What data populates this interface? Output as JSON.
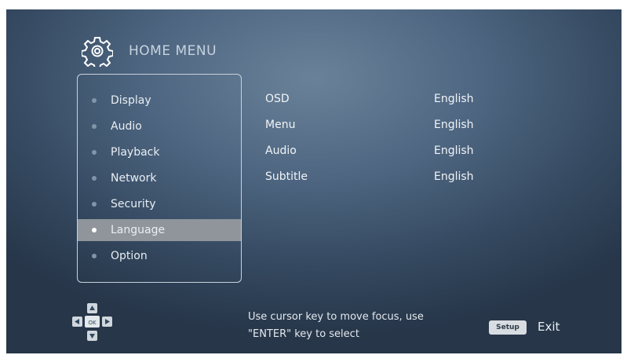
{
  "header": {
    "title": "HOME MENU",
    "icon": "gear-icon"
  },
  "menu": {
    "items": [
      {
        "label": "Display",
        "selected": false
      },
      {
        "label": "Audio",
        "selected": false
      },
      {
        "label": "Playback",
        "selected": false
      },
      {
        "label": "Network",
        "selected": false
      },
      {
        "label": "Security",
        "selected": false
      },
      {
        "label": "Language",
        "selected": true
      },
      {
        "label": "Option",
        "selected": false
      }
    ]
  },
  "settings": [
    {
      "label": "OSD",
      "value": "English"
    },
    {
      "label": "Menu",
      "value": "English"
    },
    {
      "label": "Audio",
      "value": "English"
    },
    {
      "label": "Subtitle",
      "value": "English"
    }
  ],
  "footer": {
    "dpad_center_label": "OK",
    "hint_line1": "Use cursor key to move focus, use",
    "hint_line2": "\"ENTER\" key to select",
    "setup_key_label": "Setup",
    "exit_label": "Exit"
  },
  "colors": {
    "selected_row": "#8f959b",
    "background_center": "#6a8299",
    "background_edge": "#273649"
  }
}
